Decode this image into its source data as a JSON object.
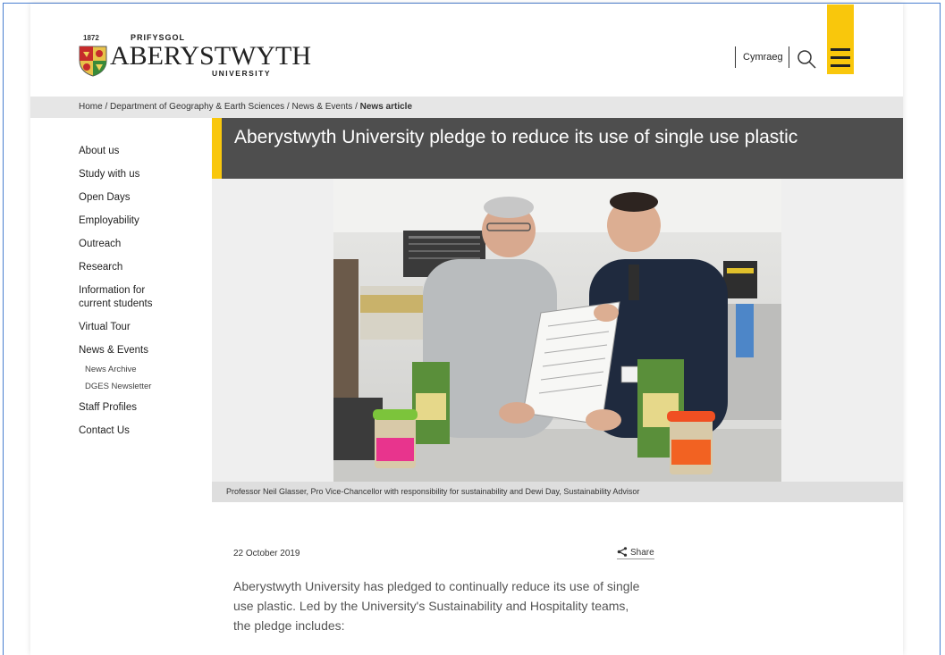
{
  "header": {
    "logo_year": "1872",
    "logo_welsh": "PRIFYSGOL",
    "logo_name": "ABERYSTWYTH",
    "logo_university": "UNIVERSITY",
    "language_link": "Cymraeg",
    "menu_color": "#f9c70c"
  },
  "breadcrumb": {
    "items": [
      "Home",
      "Department of Geography & Earth Sciences",
      "News & Events"
    ],
    "separator": " / ",
    "current": "News article"
  },
  "sidebar": {
    "items": [
      {
        "label": "About us"
      },
      {
        "label": "Study with us"
      },
      {
        "label": "Open Days"
      },
      {
        "label": "Employability"
      },
      {
        "label": "Outreach"
      },
      {
        "label": "Research"
      },
      {
        "label": "Information for current students"
      },
      {
        "label": "Virtual Tour"
      },
      {
        "label": "News & Events"
      }
    ],
    "subitems": [
      {
        "label": "News Archive"
      },
      {
        "label": "DGES Newsletter"
      }
    ],
    "items_after": [
      {
        "label": "Staff Profiles"
      },
      {
        "label": "Contact Us"
      }
    ]
  },
  "article": {
    "title": "Aberystwyth University pledge to reduce its use of single use plastic",
    "caption": "Professor Neil Glasser, Pro Vice-Chancellor with responsibility for sustainability and Dewi Day, Sustainability Advisor",
    "date": "22 October 2019",
    "share_label": "Share",
    "intro": "Aberystwyth University has pledged to continually reduce its use of single use plastic. Led by the University's Sustainability and Hospitality teams, the pledge includes:"
  }
}
